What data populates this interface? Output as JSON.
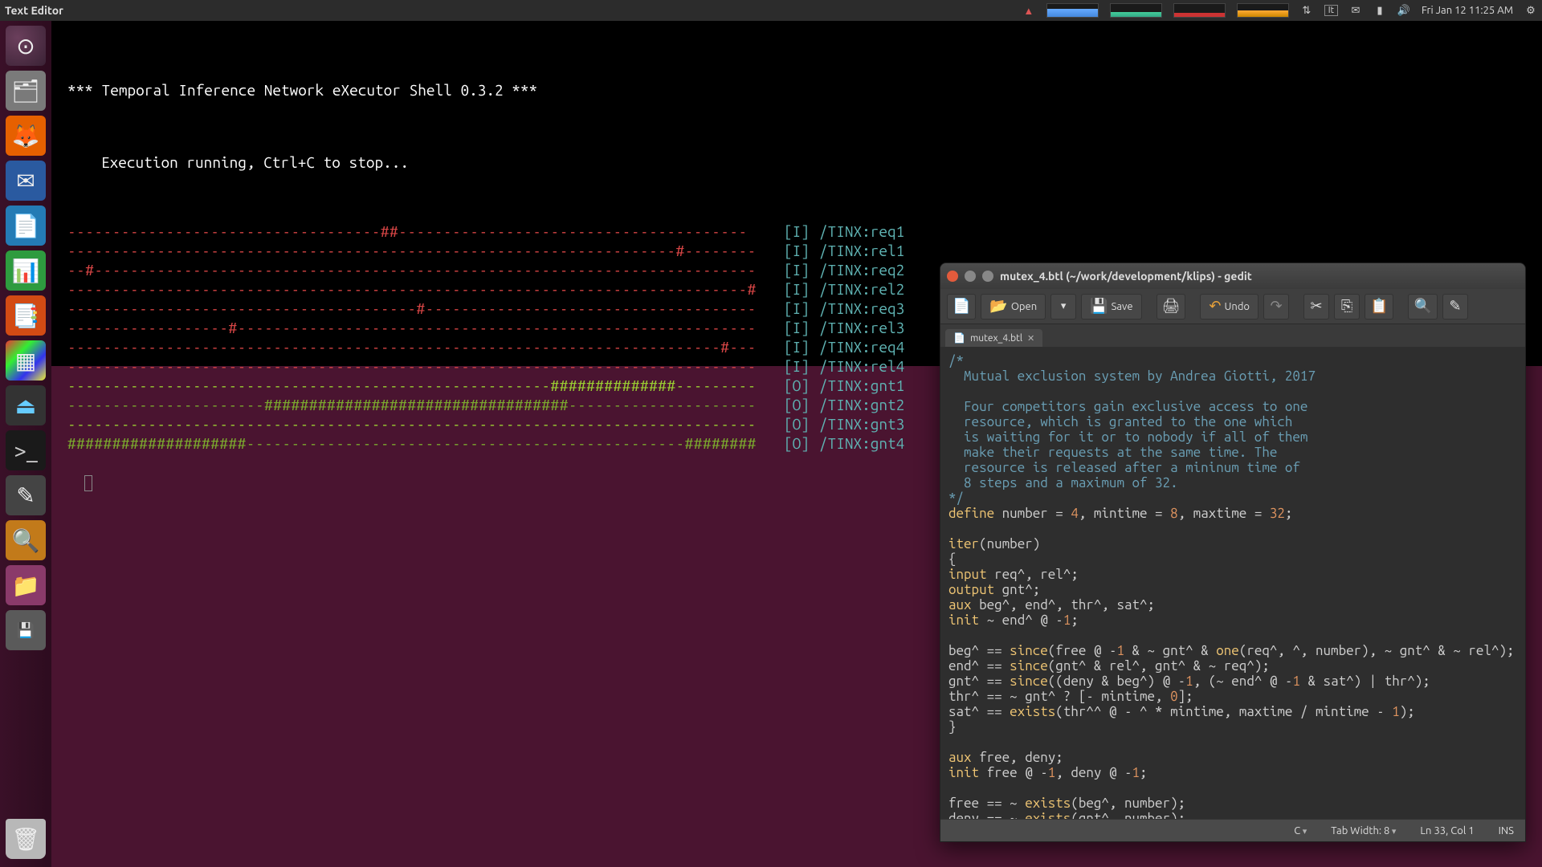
{
  "topbar": {
    "app_title": "Text Editor",
    "lang": "It",
    "datetime": "Fri Jan 12 11:25 AM"
  },
  "launcher": [
    {
      "name": "dash",
      "glyph": "◌"
    },
    {
      "name": "files",
      "glyph": "🗂"
    },
    {
      "name": "firefox",
      "glyph": "🦊"
    },
    {
      "name": "thunderbird",
      "glyph": "✉"
    },
    {
      "name": "writer",
      "glyph": "📄"
    },
    {
      "name": "calc",
      "glyph": "📊"
    },
    {
      "name": "impress",
      "glyph": "📑"
    },
    {
      "name": "software",
      "glyph": "▦"
    },
    {
      "name": "usb",
      "glyph": "⏏"
    },
    {
      "name": "terminal",
      "glyph": ">_"
    },
    {
      "name": "gedit",
      "glyph": "✎"
    },
    {
      "name": "search",
      "glyph": "🔍"
    },
    {
      "name": "filemgr",
      "glyph": "📁"
    },
    {
      "name": "media",
      "glyph": "💾"
    }
  ],
  "terminal": {
    "header": "*** Temporal Inference Network eXecutor Shell 0.3.2 ***",
    "sub": "Execution running, Ctrl+C to stop...",
    "rows": [
      {
        "cls": "red",
        "line": "-----------------------------------##---------------------------------------",
        "tag": "[I]",
        "sig": "/TINX:req1"
      },
      {
        "cls": "red",
        "line": "--------------------------------------------------------------------#--------",
        "tag": "[I]",
        "sig": "/TINX:rel1"
      },
      {
        "cls": "red",
        "line": "--#--------------------------------------------------------------------------",
        "tag": "[I]",
        "sig": "/TINX:req2"
      },
      {
        "cls": "red",
        "line": "----------------------------------------------------------------------------#",
        "tag": "[I]",
        "sig": "/TINX:rel2"
      },
      {
        "cls": "red",
        "line": "---------------------------------------#-------------------------------------",
        "tag": "[I]",
        "sig": "/TINX:req3"
      },
      {
        "cls": "red",
        "line": "------------------#----------------------------------------------------------",
        "tag": "[I]",
        "sig": "/TINX:rel3"
      },
      {
        "cls": "red",
        "line": "-------------------------------------------------------------------------#---",
        "tag": "[I]",
        "sig": "/TINX:req4"
      },
      {
        "cls": "red",
        "line": "-----------------------------------------------------------------------------",
        "tag": "[I]",
        "sig": "/TINX:rel4"
      },
      {
        "cls": "grn",
        "line": "------------------------------------------------------##############---------",
        "tag": "[O]",
        "sig": "/TINX:gnt1"
      },
      {
        "cls": "dgrn",
        "line": "----------------------##################################---------------------",
        "tag": "[O]",
        "sig": "/TINX:gnt2"
      },
      {
        "cls": "grn",
        "line": "-----------------------------------------------------------------------------",
        "tag": "[O]",
        "sig": "/TINX:gnt3"
      },
      {
        "cls": "dgrn",
        "line": "####################-------------------------------------------------########",
        "tag": "[O]",
        "sig": "/TINX:gnt4"
      }
    ]
  },
  "gedit": {
    "title": "mutex_4.btl (~/work/development/klips) - gedit",
    "toolbar": {
      "open": "Open",
      "save": "Save",
      "undo": "Undo"
    },
    "tab": "mutex_4.btl",
    "status": {
      "lang": "C",
      "tab": "Tab Width: 8",
      "pos": "Ln 33, Col 1",
      "mode": "INS"
    },
    "code_comment": "/*\n  Mutual exclusion system by Andrea Giotti, 2017\n\n  Four competitors gain exclusive access to one\n  resource, which is granted to the one which\n  is waiting for it or to nobody if all of them\n  make their requests at the same time. The\n  resource is released after a mininum time of\n  8 steps and a maximum of 32.\n*/",
    "code_body": "\ndefine number = 4, mintime = 8, maxtime = 32;\n\niter(number)\n{\ninput req^, rel^;\noutput gnt^;\naux beg^, end^, thr^, sat^;\ninit ~ end^ @ -1;\n\nbeg^ == since(free @ -1 & ~ gnt^ & one(req^, ^, number), ~ gnt^ & ~ rel^);\nend^ == since(gnt^ & rel^, gnt^ & ~ req^);\ngnt^ == since((deny & beg^) @ -1, (~ end^ @ -1 & sat^) | thr^);\nthr^ == ~ gnt^ ? [- mintime, 0];\nsat^ == exists(thr^^ @ - ^ * mintime, maxtime / mintime - 1);\n}\n\naux free, deny;\ninit free @ -1, deny @ -1;\n\nfree == ~ exists(beg^, number);\ndeny == ~ exists(gnt^, number);"
  }
}
